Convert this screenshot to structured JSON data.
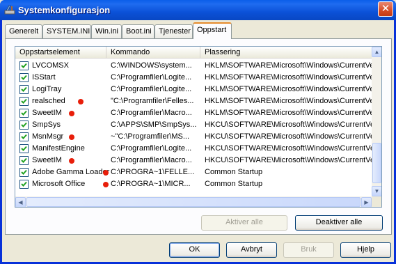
{
  "window": {
    "title": "Systemkonfigurasjon",
    "close_glyph": "✕"
  },
  "tabs": [
    {
      "label": "Generelt"
    },
    {
      "label": "SYSTEM.INI"
    },
    {
      "label": "Win.ini"
    },
    {
      "label": "Boot.ini"
    },
    {
      "label": "Tjenester"
    },
    {
      "label": "Oppstart"
    }
  ],
  "active_tab": "Oppstart",
  "list": {
    "columns": [
      "Oppstartselement",
      "Kommando",
      "Plassering"
    ],
    "rows": [
      {
        "checked": true,
        "name": "LVCOMSX",
        "command": "C:\\WINDOWS\\system...",
        "location": "HKLM\\SOFTWARE\\Microsoft\\Windows\\CurrentVer...",
        "marker": false
      },
      {
        "checked": true,
        "name": "ISStart",
        "command": "C:\\Programfiler\\Logite...",
        "location": "HKLM\\SOFTWARE\\Microsoft\\Windows\\CurrentVer...",
        "marker": false
      },
      {
        "checked": true,
        "name": "LogiTray",
        "command": "C:\\Programfiler\\Logite...",
        "location": "HKLM\\SOFTWARE\\Microsoft\\Windows\\CurrentVer...",
        "marker": false
      },
      {
        "checked": true,
        "name": "realsched",
        "command": "\"C:\\Programfiler\\Felles...",
        "location": "HKLM\\SOFTWARE\\Microsoft\\Windows\\CurrentVer...",
        "marker": true
      },
      {
        "checked": true,
        "name": "SweetIM",
        "command": "C:\\Programfiler\\Macro...",
        "location": "HKLM\\SOFTWARE\\Microsoft\\Windows\\CurrentVer...",
        "marker": true
      },
      {
        "checked": true,
        "name": "SmpSys",
        "command": "C:\\APPS\\SMP\\SmpSys...",
        "location": "HKCU\\SOFTWARE\\Microsoft\\Windows\\CurrentVer...",
        "marker": false
      },
      {
        "checked": true,
        "name": "MsnMsgr",
        "command": "~\"C:\\Programfiler\\MS...",
        "location": "HKCU\\SOFTWARE\\Microsoft\\Windows\\CurrentVer...",
        "marker": true
      },
      {
        "checked": true,
        "name": "ManifestEngine",
        "command": "C:\\Programfiler\\Logite...",
        "location": "HKCU\\SOFTWARE\\Microsoft\\Windows\\CurrentVer...",
        "marker": false
      },
      {
        "checked": true,
        "name": "SweetIM",
        "command": "C:\\Programfiler\\Macro...",
        "location": "HKCU\\SOFTWARE\\Microsoft\\Windows\\CurrentVer...",
        "marker": true
      },
      {
        "checked": true,
        "name": "Adobe Gamma Loader",
        "command": "C:\\PROGRA~1\\FELLE...",
        "location": "Common Startup",
        "marker": true
      },
      {
        "checked": true,
        "name": "Microsoft Office",
        "command": "C:\\PROGRA~1\\MICR...",
        "location": "Common Startup",
        "marker": true
      }
    ]
  },
  "panel_buttons": {
    "enable_all": "Aktiver alle",
    "disable_all": "Deaktiver alle"
  },
  "dialog_buttons": {
    "ok": "OK",
    "cancel": "Avbryt",
    "apply": "Bruk",
    "help": "Hjelp"
  },
  "colors": {
    "marker": "#e81e0a",
    "title_bar": "#0b51d8",
    "face": "#ece9d8"
  }
}
